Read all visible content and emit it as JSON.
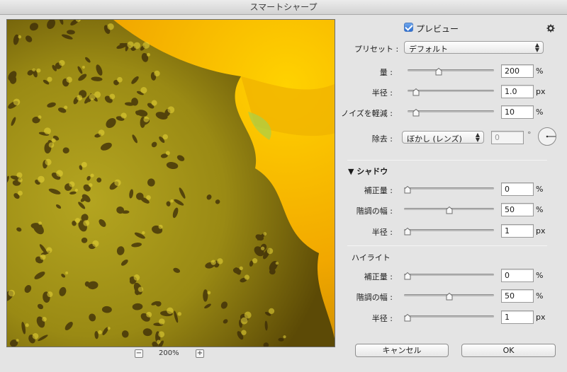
{
  "window": {
    "title": "スマートシャープ"
  },
  "header": {
    "preview_label": "プレビュー",
    "preview_checked": true,
    "gear_icon": "gear-icon"
  },
  "preset": {
    "label": "プリセット :",
    "value": "デフォルト"
  },
  "sharpen": {
    "amount": {
      "label": "量 :",
      "value": "200",
      "unit": "%",
      "level": 0.36
    },
    "radius": {
      "label": "半径 :",
      "value": "1.0",
      "unit": "px",
      "level": 0.1
    },
    "noise": {
      "label": "ノイズを軽減 :",
      "value": "10",
      "unit": "%",
      "level": 0.1
    },
    "remove": {
      "label": "除去 :",
      "value": "ぼかし (レンズ)",
      "angle_value": "0",
      "angle_unit": "°"
    }
  },
  "shadow": {
    "title": "▼ シャドウ",
    "fade": {
      "label": "補正量 :",
      "value": "0",
      "unit": "%",
      "level": 0.0
    },
    "tonal_width": {
      "label": "階調の幅 :",
      "value": "50",
      "unit": "%",
      "level": 0.5
    },
    "radius": {
      "label": "半径 :",
      "value": "1",
      "unit": "px",
      "level": 0.0
    }
  },
  "highlight": {
    "title": "ハイライト",
    "fade": {
      "label": "補正量 :",
      "value": "0",
      "unit": "%",
      "level": 0.0
    },
    "tonal_width": {
      "label": "階調の幅 :",
      "value": "50",
      "unit": "%",
      "level": 0.5
    },
    "radius": {
      "label": "半径 :",
      "value": "1",
      "unit": "px",
      "level": 0.0
    }
  },
  "zoom": {
    "value": "200%",
    "minus": "−",
    "plus": "+"
  },
  "buttons": {
    "cancel": "キャンセル",
    "ok": "OK"
  },
  "colors": {
    "accent": "#2e6fd2",
    "petal": "#f5b800",
    "disk": "#8a7a10"
  }
}
